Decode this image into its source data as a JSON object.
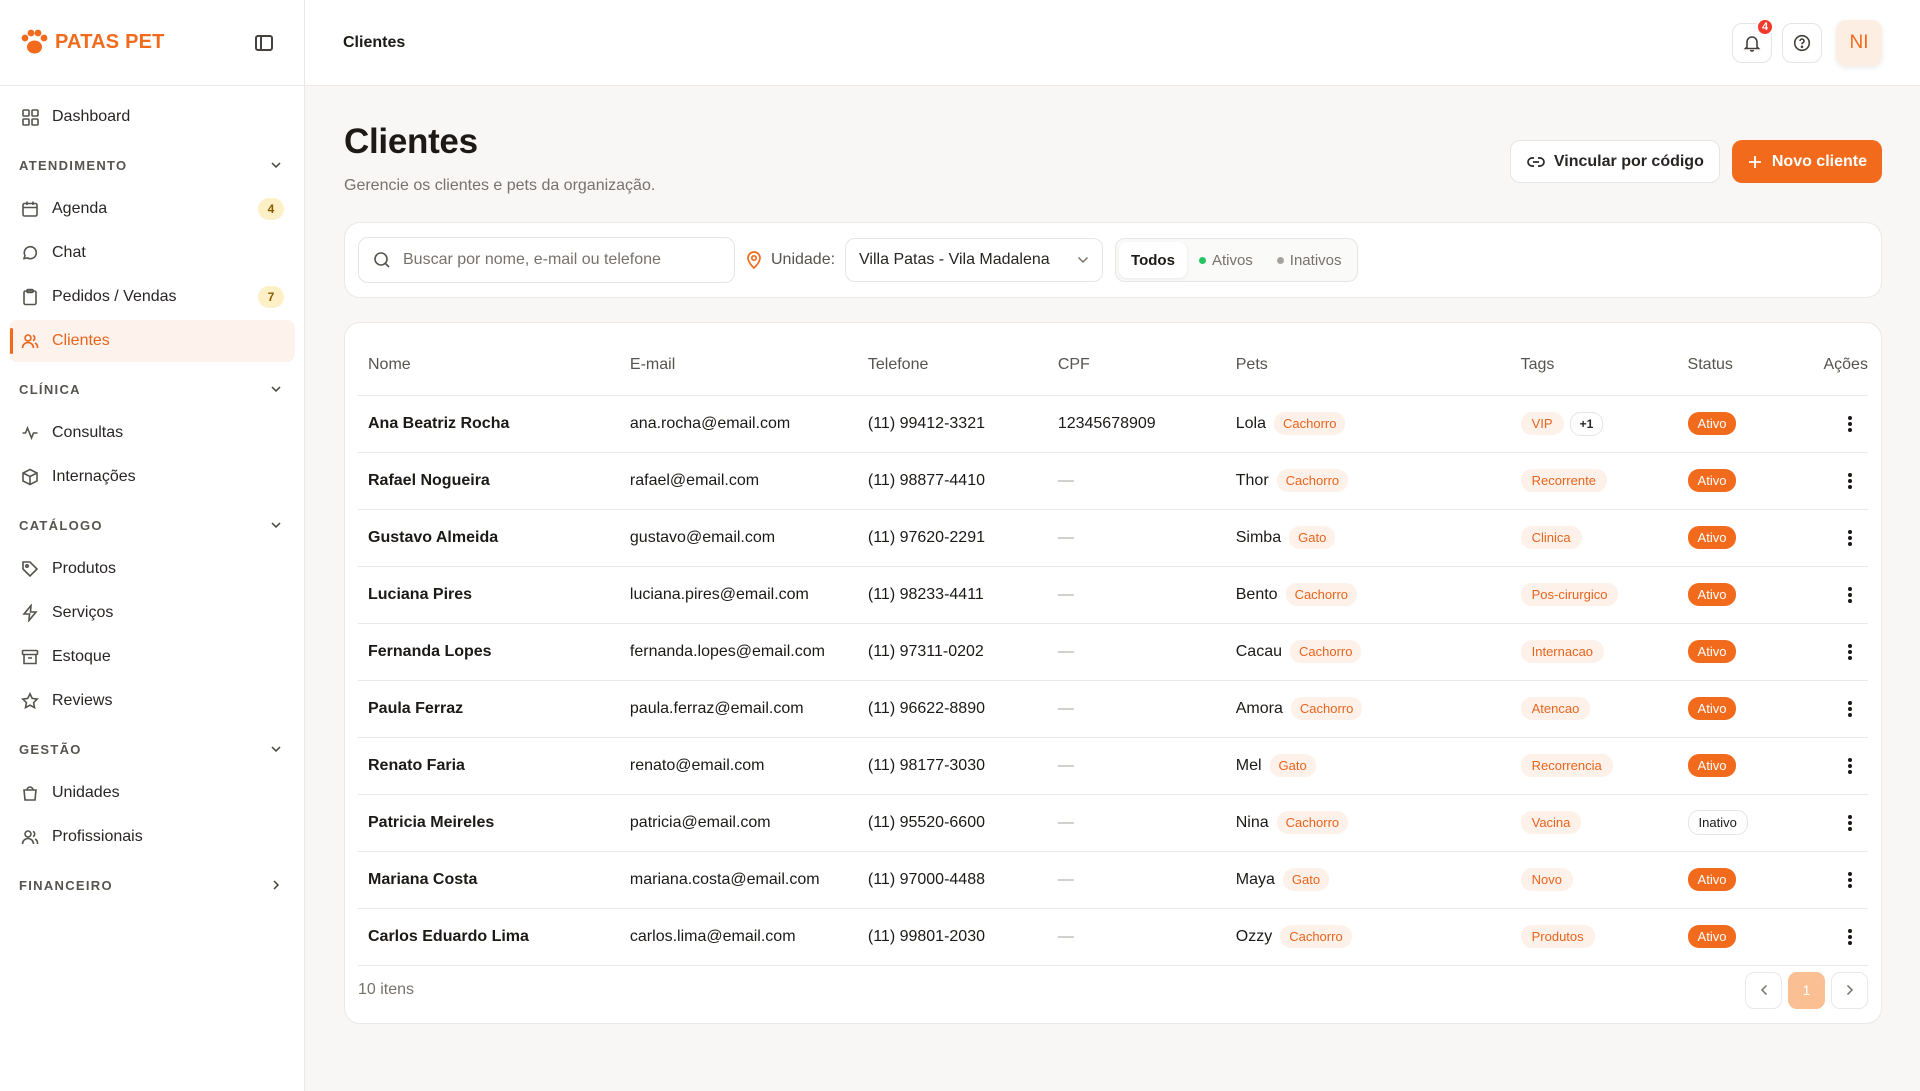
{
  "brand": {
    "name": "PATAS PET",
    "color": "#f26b1d"
  },
  "sidebar": {
    "dashboard": {
      "label": "Dashboard",
      "icon": "grid-icon"
    },
    "sections": [
      {
        "title": "ATENDIMENTO",
        "expanded": true,
        "items": [
          {
            "label": "Agenda",
            "icon": "calendar-icon",
            "badge": "4"
          },
          {
            "label": "Chat",
            "icon": "chat-icon"
          },
          {
            "label": "Pedidos / Vendas",
            "icon": "clipboard-icon",
            "badge": "7"
          },
          {
            "label": "Clientes",
            "icon": "users-icon",
            "active": true
          }
        ]
      },
      {
        "title": "CLÍNICA",
        "expanded": true,
        "items": [
          {
            "label": "Consultas",
            "icon": "activity-icon"
          },
          {
            "label": "Internações",
            "icon": "box-icon"
          }
        ]
      },
      {
        "title": "CATÁLOGO",
        "expanded": true,
        "items": [
          {
            "label": "Produtos",
            "icon": "tag-icon"
          },
          {
            "label": "Serviços",
            "icon": "zap-icon"
          },
          {
            "label": "Estoque",
            "icon": "archive-icon"
          },
          {
            "label": "Reviews",
            "icon": "star-icon"
          }
        ]
      },
      {
        "title": "GESTÃO",
        "expanded": true,
        "items": [
          {
            "label": "Unidades",
            "icon": "store-icon"
          },
          {
            "label": "Profissionais",
            "icon": "users-icon"
          }
        ]
      },
      {
        "title": "FINANCEIRO",
        "expanded": false,
        "items": []
      }
    ]
  },
  "topbar": {
    "breadcrumb": "Clientes",
    "notifications": "4",
    "avatar_initials": "NI"
  },
  "page": {
    "title": "Clientes",
    "subtitle": "Gerencie os clientes e pets da organização.",
    "link_button": "Vincular por código",
    "new_button": "Novo cliente"
  },
  "filters": {
    "search_placeholder": "Buscar por nome, e-mail ou telefone",
    "unit_label": "Unidade:",
    "unit_value": "Villa Patas - Vila Madalena",
    "segments": [
      {
        "label": "Todos",
        "selected": true
      },
      {
        "label": "Ativos",
        "dot": "#22c55e"
      },
      {
        "label": "Inativos",
        "dot": "#a8a29e"
      }
    ]
  },
  "table": {
    "columns": [
      "Nome",
      "E-mail",
      "Telefone",
      "CPF",
      "Pets",
      "Tags",
      "Status",
      "Ações"
    ],
    "rows": [
      {
        "name": "Ana Beatriz Rocha",
        "email": "ana.rocha@email.com",
        "phone": "(11) 99412-3321",
        "cpf": "12345678909",
        "pet": "Lola",
        "species": "Cachorro",
        "tag": "VIP",
        "tag_more": "+1",
        "status": "Ativo"
      },
      {
        "name": "Rafael Nogueira",
        "email": "rafael@email.com",
        "phone": "(11) 98877-4410",
        "cpf": "—",
        "pet": "Thor",
        "species": "Cachorro",
        "tag": "Recorrente",
        "status": "Ativo"
      },
      {
        "name": "Gustavo Almeida",
        "email": "gustavo@email.com",
        "phone": "(11) 97620-2291",
        "cpf": "—",
        "pet": "Simba",
        "species": "Gato",
        "tag": "Clinica",
        "status": "Ativo"
      },
      {
        "name": "Luciana Pires",
        "email": "luciana.pires@email.com",
        "phone": "(11) 98233-4411",
        "cpf": "—",
        "pet": "Bento",
        "species": "Cachorro",
        "tag": "Pos-cirurgico",
        "status": "Ativo"
      },
      {
        "name": "Fernanda Lopes",
        "email": "fernanda.lopes@email.com",
        "phone": "(11) 97311-0202",
        "cpf": "—",
        "pet": "Cacau",
        "species": "Cachorro",
        "tag": "Internacao",
        "status": "Ativo"
      },
      {
        "name": "Paula Ferraz",
        "email": "paula.ferraz@email.com",
        "phone": "(11) 96622-8890",
        "cpf": "—",
        "pet": "Amora",
        "species": "Cachorro",
        "tag": "Atencao",
        "status": "Ativo"
      },
      {
        "name": "Renato Faria",
        "email": "renato@email.com",
        "phone": "(11) 98177-3030",
        "cpf": "—",
        "pet": "Mel",
        "species": "Gato",
        "tag": "Recorrencia",
        "status": "Ativo"
      },
      {
        "name": "Patricia Meireles",
        "email": "patricia@email.com",
        "phone": "(11) 95520-6600",
        "cpf": "—",
        "pet": "Nina",
        "species": "Cachorro",
        "tag": "Vacina",
        "status": "Inativo"
      },
      {
        "name": "Mariana Costa",
        "email": "mariana.costa@email.com",
        "phone": "(11) 97000-4488",
        "cpf": "—",
        "pet": "Maya",
        "species": "Gato",
        "tag": "Novo",
        "status": "Ativo"
      },
      {
        "name": "Carlos Eduardo Lima",
        "email": "carlos.lima@email.com",
        "phone": "(11) 99801-2030",
        "cpf": "—",
        "pet": "Ozzy",
        "species": "Cachorro",
        "tag": "Produtos",
        "status": "Ativo"
      }
    ],
    "count": "10 itens",
    "current_page": "1"
  }
}
